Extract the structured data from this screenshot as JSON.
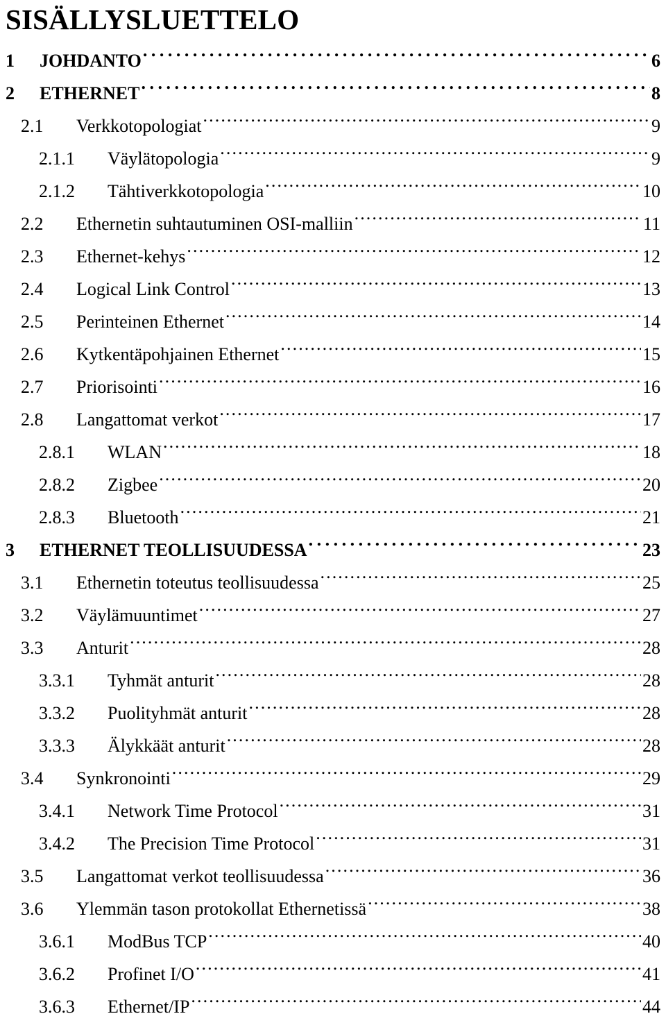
{
  "document": {
    "title": "SISÄLLYSLUETTELO",
    "leader_char": "."
  },
  "toc": {
    "entries": [
      {
        "level": 1,
        "number": "1",
        "label": "JOHDANTO",
        "page": "6"
      },
      {
        "level": 1,
        "number": "2",
        "label": "ETHERNET",
        "page": "8"
      },
      {
        "level": 2,
        "number": "2.1",
        "label": "Verkkotopologiat",
        "page": "9"
      },
      {
        "level": 3,
        "number": "2.1.1",
        "label": "Väylätopologia",
        "page": "9"
      },
      {
        "level": 3,
        "number": "2.1.2",
        "label": "Tähtiverkkotopologia",
        "page": "10"
      },
      {
        "level": 2,
        "number": "2.2",
        "label": "Ethernetin suhtautuminen OSI-malliin",
        "page": "11"
      },
      {
        "level": 2,
        "number": "2.3",
        "label": "Ethernet-kehys",
        "page": "12"
      },
      {
        "level": 2,
        "number": "2.4",
        "label": "Logical Link Control",
        "page": "13"
      },
      {
        "level": 2,
        "number": "2.5",
        "label": "Perinteinen Ethernet",
        "page": "14"
      },
      {
        "level": 2,
        "number": "2.6",
        "label": "Kytkentäpohjainen Ethernet",
        "page": "15"
      },
      {
        "level": 2,
        "number": "2.7",
        "label": "Priorisointi",
        "page": "16"
      },
      {
        "level": 2,
        "number": "2.8",
        "label": "Langattomat verkot",
        "page": "17"
      },
      {
        "level": 3,
        "number": "2.8.1",
        "label": "WLAN",
        "page": "18"
      },
      {
        "level": 3,
        "number": "2.8.2",
        "label": "Zigbee",
        "page": "20"
      },
      {
        "level": 3,
        "number": "2.8.3",
        "label": "Bluetooth",
        "page": "21"
      },
      {
        "level": 1,
        "number": "3",
        "label": "ETHERNET TEOLLISUUDESSA",
        "page": "23"
      },
      {
        "level": 2,
        "number": "3.1",
        "label": "Ethernetin toteutus teollisuudessa",
        "page": "25"
      },
      {
        "level": 2,
        "number": "3.2",
        "label": "Väylämuuntimet",
        "page": "27"
      },
      {
        "level": 2,
        "number": "3.3",
        "label": "Anturit",
        "page": "28"
      },
      {
        "level": 3,
        "number": "3.3.1",
        "label": "Tyhmät anturit",
        "page": "28"
      },
      {
        "level": 3,
        "number": "3.3.2",
        "label": "Puolityhmät anturit",
        "page": "28"
      },
      {
        "level": 3,
        "number": "3.3.3",
        "label": "Älykkäät anturit",
        "page": "28"
      },
      {
        "level": 2,
        "number": "3.4",
        "label": "Synkronointi",
        "page": "29"
      },
      {
        "level": 3,
        "number": "3.4.1",
        "label": "Network Time Protocol",
        "page": "31"
      },
      {
        "level": 3,
        "number": "3.4.2",
        "label": "The Precision Time Protocol",
        "page": "31"
      },
      {
        "level": 2,
        "number": "3.5",
        "label": "Langattomat verkot teollisuudessa",
        "page": "36"
      },
      {
        "level": 2,
        "number": "3.6",
        "label": "Ylemmän tason protokollat Ethernetissä",
        "page": "38"
      },
      {
        "level": 3,
        "number": "3.6.1",
        "label": "ModBus TCP",
        "page": "40"
      },
      {
        "level": 3,
        "number": "3.6.2",
        "label": "Profinet I/O",
        "page": "41"
      },
      {
        "level": 3,
        "number": "3.6.3",
        "label": "Ethernet/IP",
        "page": "44"
      }
    ]
  }
}
